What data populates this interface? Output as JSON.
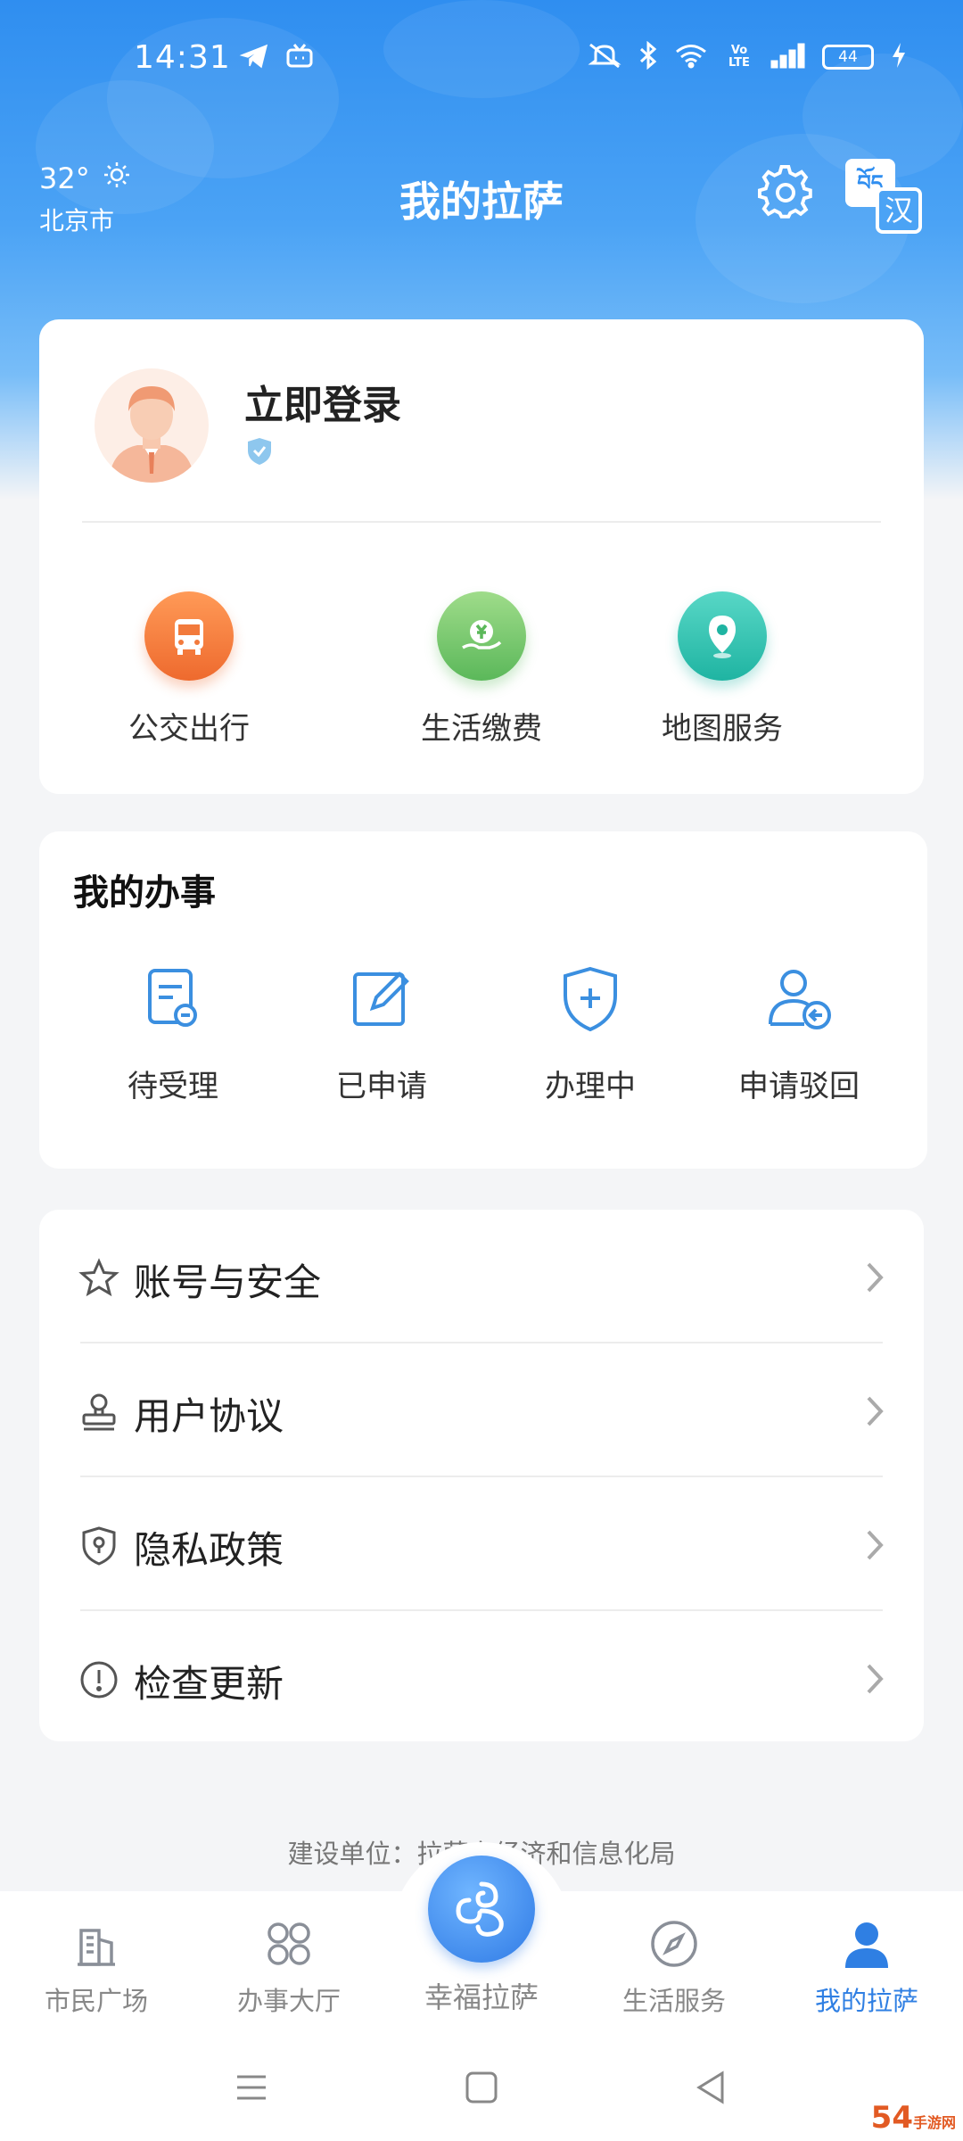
{
  "status_bar": {
    "time": "14:31",
    "battery": "44",
    "network_label": "Vo LTE"
  },
  "header": {
    "temperature": "32°",
    "city": "北京市",
    "title": "我的拉萨",
    "settings_icon": "gear-icon",
    "language_icon": "tibetan-chinese-switch-icon",
    "language_char": "汉",
    "language_tibetan": "བོད"
  },
  "profile": {
    "login_text": "立即登录"
  },
  "quick_services": [
    {
      "label": "公交出行",
      "icon": "bus-icon",
      "color": "#f27a3c"
    },
    {
      "label": "生活缴费",
      "icon": "payment-icon",
      "color": "#6cc56a"
    },
    {
      "label": "地图服务",
      "icon": "map-pin-icon",
      "color": "#2ec3b2"
    }
  ],
  "my_affairs": {
    "title": "我的办事",
    "items": [
      {
        "label": "待受理",
        "icon": "pending-doc-icon"
      },
      {
        "label": "已申请",
        "icon": "edit-doc-icon"
      },
      {
        "label": "办理中",
        "icon": "shield-plus-icon"
      },
      {
        "label": "申请驳回",
        "icon": "user-return-icon"
      }
    ]
  },
  "menu": [
    {
      "label": "账号与安全",
      "icon": "star-icon"
    },
    {
      "label": "用户协议",
      "icon": "stamp-icon"
    },
    {
      "label": "隐私政策",
      "icon": "shield-lock-icon"
    },
    {
      "label": "检查更新",
      "icon": "info-circle-icon"
    }
  ],
  "footer_note": "建设单位：拉萨市经济和信息化局",
  "tabbar": {
    "items": [
      {
        "label": "市民广场",
        "icon": "building-icon"
      },
      {
        "label": "办事大厅",
        "icon": "grid-icon"
      },
      {
        "label": "幸福拉萨",
        "icon": "auspicious-cloud-icon"
      },
      {
        "label": "生活服务",
        "icon": "compass-icon"
      },
      {
        "label": "我的拉萨",
        "icon": "person-icon"
      }
    ],
    "active_index": 4,
    "active_color": "#2f7fe3"
  },
  "watermark": {
    "text": "54",
    "sub": "手游网"
  },
  "colors": {
    "header_blue": "#2f8ef0",
    "accent": "#2f7fe3",
    "icon_blue": "#3b8fe0"
  }
}
